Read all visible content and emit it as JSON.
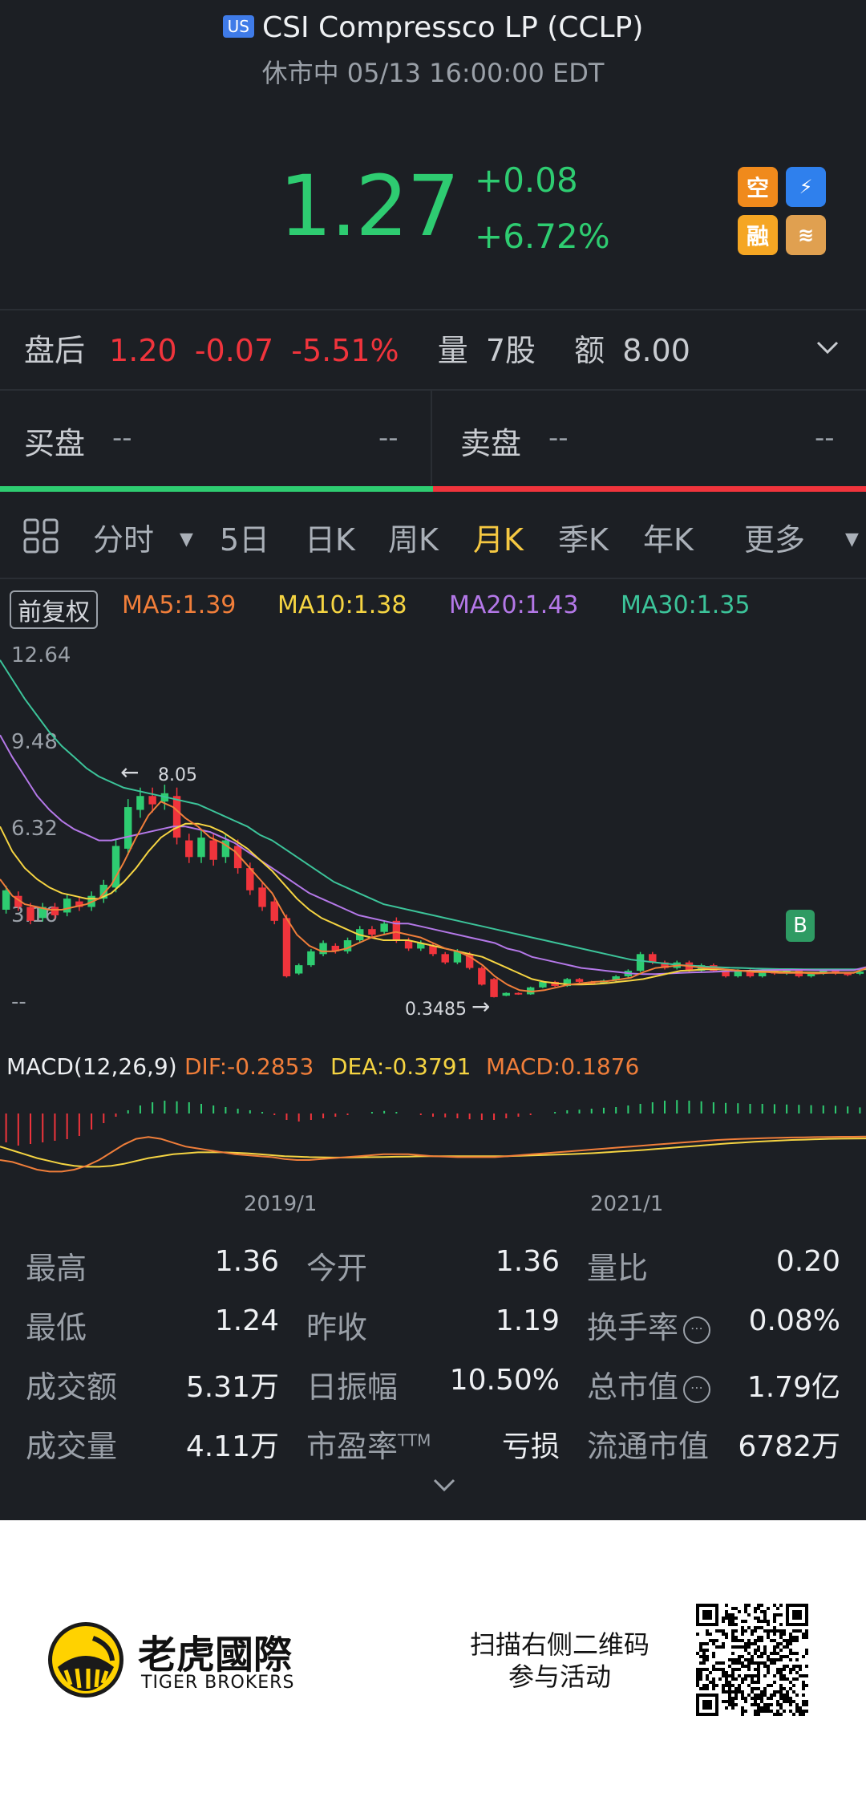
{
  "header": {
    "market_badge": "US",
    "title": "CSI Compressco LP (CCLP)",
    "status": "休市中 05/13 16:00:00 EDT",
    "price": "1.27",
    "change": "+0.08",
    "change_pct": "+6.72%",
    "icons": [
      {
        "name": "short-sell-icon",
        "text": "空",
        "color": "#f08a1c"
      },
      {
        "name": "level1-icon",
        "text": "⚡1",
        "color": "#2f80ed"
      },
      {
        "name": "margin-icon",
        "text": "融",
        "color": "#f5a623"
      },
      {
        "name": "options-icon",
        "text": "A",
        "color": "#e0a050"
      }
    ]
  },
  "after_hours": {
    "label": "盘后",
    "price": "1.20",
    "change": "-0.07",
    "change_pct": "-5.51%",
    "volume_label": "量",
    "volume": "7股",
    "amount_label": "额",
    "amount": "8.00"
  },
  "order_book": {
    "bid_label": "买盘",
    "bid_price": "--",
    "bid_size": "--",
    "ask_label": "卖盘",
    "ask_price": "--",
    "ask_size": "--"
  },
  "tabs": {
    "items": [
      "分时",
      "5日",
      "日K",
      "周K",
      "月K",
      "季K",
      "年K",
      "更多"
    ],
    "active": "月K"
  },
  "chart_legend": {
    "adjust": "前复权",
    "ma5": "MA5:1.39",
    "ma10": "MA10:1.38",
    "ma20": "MA20:1.43",
    "ma30": "MA30:1.35"
  },
  "colors": {
    "up": "#2ecc71",
    "down": "#f0343c",
    "ma5": "#f07e3a",
    "ma10": "#f5d442",
    "ma20": "#b478e8",
    "ma30": "#3cc49a",
    "accent": "#f5c842"
  },
  "chart_data": {
    "type": "candlestick",
    "y_ticks": [
      "12.64",
      "9.48",
      "6.32",
      "3.16",
      "--"
    ],
    "x_ticks": [
      "2019/1",
      "2021/1"
    ],
    "ylim": [
      0,
      12.64
    ],
    "annotations": {
      "high_label": "8.05",
      "low_label": "0.3485",
      "buy_marker": "B"
    },
    "candles": [
      {
        "o": 3.5,
        "c": 4.2
      },
      {
        "o": 4.0,
        "c": 3.6
      },
      {
        "o": 3.6,
        "c": 3.1
      },
      {
        "o": 3.2,
        "c": 3.6
      },
      {
        "o": 3.6,
        "c": 3.3
      },
      {
        "o": 3.4,
        "c": 3.9
      },
      {
        "o": 3.8,
        "c": 3.6
      },
      {
        "o": 3.6,
        "c": 4.0
      },
      {
        "o": 3.9,
        "c": 4.4
      },
      {
        "o": 4.3,
        "c": 5.8
      },
      {
        "o": 5.7,
        "c": 7.2
      },
      {
        "o": 7.1,
        "c": 7.6
      },
      {
        "o": 7.6,
        "c": 7.3
      },
      {
        "o": 7.4,
        "c": 7.7
      },
      {
        "o": 7.6,
        "c": 6.1
      },
      {
        "o": 6.0,
        "c": 5.4
      },
      {
        "o": 5.4,
        "c": 6.1
      },
      {
        "o": 6.0,
        "c": 5.3
      },
      {
        "o": 5.4,
        "c": 6.0
      },
      {
        "o": 5.8,
        "c": 5.0
      },
      {
        "o": 5.0,
        "c": 4.2
      },
      {
        "o": 4.3,
        "c": 3.6
      },
      {
        "o": 3.8,
        "c": 3.1
      },
      {
        "o": 3.2,
        "c": 1.1
      },
      {
        "o": 1.2,
        "c": 1.5
      },
      {
        "o": 1.5,
        "c": 2.0
      },
      {
        "o": 1.9,
        "c": 2.3
      },
      {
        "o": 2.2,
        "c": 2.0
      },
      {
        "o": 2.0,
        "c": 2.4
      },
      {
        "o": 2.4,
        "c": 2.8
      },
      {
        "o": 2.8,
        "c": 2.6
      },
      {
        "o": 2.7,
        "c": 3.0
      },
      {
        "o": 3.1,
        "c": 2.4
      },
      {
        "o": 2.4,
        "c": 2.1
      },
      {
        "o": 2.1,
        "c": 2.3
      },
      {
        "o": 2.2,
        "c": 1.9
      },
      {
        "o": 1.9,
        "c": 1.6
      },
      {
        "o": 1.6,
        "c": 2.0
      },
      {
        "o": 1.9,
        "c": 1.4
      },
      {
        "o": 1.4,
        "c": 0.8
      },
      {
        "o": 1.0,
        "c": 0.35
      },
      {
        "o": 0.4,
        "c": 0.5
      },
      {
        "o": 0.5,
        "c": 0.45
      },
      {
        "o": 0.45,
        "c": 0.7
      },
      {
        "o": 0.7,
        "c": 0.9
      },
      {
        "o": 0.9,
        "c": 0.75
      },
      {
        "o": 0.75,
        "c": 1.0
      },
      {
        "o": 1.0,
        "c": 0.9
      },
      {
        "o": 0.9,
        "c": 0.85
      },
      {
        "o": 0.85,
        "c": 0.95
      },
      {
        "o": 0.95,
        "c": 1.1
      },
      {
        "o": 1.1,
        "c": 1.3
      },
      {
        "o": 1.3,
        "c": 1.9
      },
      {
        "o": 1.9,
        "c": 1.6
      },
      {
        "o": 1.6,
        "c": 1.4
      },
      {
        "o": 1.4,
        "c": 1.6
      },
      {
        "o": 1.6,
        "c": 1.3
      },
      {
        "o": 1.3,
        "c": 1.5
      },
      {
        "o": 1.5,
        "c": 1.3
      },
      {
        "o": 1.3,
        "c": 1.1
      },
      {
        "o": 1.1,
        "c": 1.3
      },
      {
        "o": 1.3,
        "c": 1.1
      },
      {
        "o": 1.1,
        "c": 1.3
      },
      {
        "o": 1.3,
        "c": 1.2
      },
      {
        "o": 1.2,
        "c": 1.3
      },
      {
        "o": 1.3,
        "c": 1.1
      },
      {
        "o": 1.1,
        "c": 1.2
      },
      {
        "o": 1.2,
        "c": 1.3
      },
      {
        "o": 1.3,
        "c": 1.2
      },
      {
        "o": 1.2,
        "c": 1.15
      },
      {
        "o": 1.19,
        "c": 1.27
      }
    ],
    "ma5": [
      4.6,
      4.0,
      3.7,
      3.6,
      3.5,
      3.5,
      3.6,
      3.7,
      3.9,
      4.4,
      5.2,
      6.1,
      6.9,
      7.4,
      7.2,
      6.8,
      6.5,
      6.1,
      5.9,
      5.6,
      5.1,
      4.6,
      4.1,
      3.3,
      2.6,
      2.2,
      2.0,
      2.0,
      2.1,
      2.3,
      2.5,
      2.6,
      2.7,
      2.6,
      2.5,
      2.3,
      2.1,
      2.0,
      1.8,
      1.5,
      1.1,
      0.8,
      0.6,
      0.55,
      0.6,
      0.7,
      0.8,
      0.85,
      0.9,
      0.92,
      0.98,
      1.05,
      1.25,
      1.4,
      1.45,
      1.5,
      1.45,
      1.4,
      1.38,
      1.33,
      1.3,
      1.25,
      1.25,
      1.22,
      1.22,
      1.22,
      1.2,
      1.22,
      1.22,
      1.22,
      1.39
    ],
    "ma10": [
      6.5,
      5.6,
      5.0,
      4.6,
      4.3,
      4.1,
      4.0,
      3.9,
      3.9,
      4.1,
      4.5,
      5.0,
      5.6,
      6.1,
      6.4,
      6.6,
      6.6,
      6.5,
      6.3,
      6.0,
      5.7,
      5.3,
      4.9,
      4.4,
      3.9,
      3.5,
      3.2,
      3.0,
      2.8,
      2.6,
      2.5,
      2.4,
      2.4,
      2.4,
      2.3,
      2.2,
      2.1,
      2.0,
      1.9,
      1.8,
      1.6,
      1.4,
      1.2,
      1.0,
      0.9,
      0.85,
      0.8,
      0.8,
      0.82,
      0.85,
      0.9,
      0.95,
      1.0,
      1.1,
      1.2,
      1.3,
      1.32,
      1.35,
      1.35,
      1.33,
      1.3,
      1.28,
      1.27,
      1.26,
      1.25,
      1.24,
      1.23,
      1.23,
      1.23,
      1.23,
      1.38
    ],
    "ma20": [
      9.8,
      9.0,
      8.3,
      7.6,
      7.1,
      6.7,
      6.4,
      6.2,
      6.0,
      6.0,
      6.1,
      6.2,
      6.3,
      6.4,
      6.5,
      6.5,
      6.4,
      6.3,
      6.1,
      5.9,
      5.6,
      5.3,
      5.0,
      4.7,
      4.4,
      4.1,
      3.9,
      3.7,
      3.5,
      3.3,
      3.2,
      3.1,
      3.0,
      3.0,
      2.9,
      2.8,
      2.7,
      2.6,
      2.5,
      2.4,
      2.3,
      2.1,
      2.0,
      1.8,
      1.7,
      1.6,
      1.5,
      1.4,
      1.35,
      1.3,
      1.25,
      1.2,
      1.18,
      1.18,
      1.2,
      1.22,
      1.24,
      1.25,
      1.27,
      1.29,
      1.3,
      1.31,
      1.32,
      1.33,
      1.33,
      1.33,
      1.32,
      1.32,
      1.32,
      1.32,
      1.43
    ],
    "ma30": [
      12.5,
      11.8,
      11.1,
      10.5,
      9.9,
      9.4,
      9.0,
      8.6,
      8.3,
      8.1,
      7.9,
      7.8,
      7.7,
      7.6,
      7.5,
      7.4,
      7.3,
      7.1,
      6.9,
      6.7,
      6.5,
      6.2,
      6.0,
      5.7,
      5.4,
      5.1,
      4.8,
      4.5,
      4.3,
      4.1,
      3.9,
      3.7,
      3.6,
      3.5,
      3.4,
      3.3,
      3.2,
      3.1,
      3.0,
      2.9,
      2.8,
      2.7,
      2.6,
      2.5,
      2.4,
      2.3,
      2.2,
      2.1,
      2.0,
      1.9,
      1.8,
      1.7,
      1.65,
      1.6,
      1.55,
      1.5,
      1.48,
      1.45,
      1.43,
      1.41,
      1.4,
      1.38,
      1.37,
      1.36,
      1.36,
      1.35,
      1.35,
      1.35,
      1.35,
      1.35,
      1.35
    ],
    "macd": {
      "label": "MACD(12,26,9)",
      "dif_label": "DIF:-0.2853",
      "dea_label": "DEA:-0.3791",
      "macd_label": "MACD:0.1876",
      "hist": [
        -0.9,
        -1.0,
        -0.95,
        -0.9,
        -0.85,
        -0.8,
        -0.7,
        -0.5,
        -0.3,
        -0.1,
        0.1,
        0.25,
        0.35,
        0.4,
        0.38,
        0.35,
        0.3,
        0.25,
        0.2,
        0.15,
        0.1,
        0.05,
        -0.05,
        -0.2,
        -0.25,
        -0.2,
        -0.15,
        -0.1,
        -0.05,
        0.0,
        0.05,
        0.08,
        0.05,
        0.0,
        -0.05,
        -0.1,
        -0.12,
        -0.15,
        -0.18,
        -0.2,
        -0.2,
        -0.15,
        -0.1,
        -0.05,
        0.0,
        0.05,
        0.1,
        0.12,
        0.15,
        0.18,
        0.2,
        0.25,
        0.3,
        0.35,
        0.4,
        0.42,
        0.4,
        0.38,
        0.35,
        0.33,
        0.32,
        0.3,
        0.3,
        0.29,
        0.28,
        0.27,
        0.26,
        0.25,
        0.24,
        0.22,
        0.19
      ],
      "dif": [
        -1.5,
        -1.6,
        -1.8,
        -2.0,
        -2.1,
        -2.1,
        -2.0,
        -1.8,
        -1.5,
        -1.1,
        -0.7,
        -0.4,
        -0.3,
        -0.4,
        -0.6,
        -0.8,
        -0.9,
        -1.0,
        -1.1,
        -1.2,
        -1.25,
        -1.3,
        -1.35,
        -1.45,
        -1.5,
        -1.5,
        -1.45,
        -1.4,
        -1.35,
        -1.3,
        -1.25,
        -1.2,
        -1.2,
        -1.2,
        -1.25,
        -1.3,
        -1.32,
        -1.35,
        -1.35,
        -1.35,
        -1.35,
        -1.3,
        -1.25,
        -1.2,
        -1.15,
        -1.1,
        -1.05,
        -1.0,
        -0.95,
        -0.9,
        -0.85,
        -0.8,
        -0.75,
        -0.7,
        -0.65,
        -0.6,
        -0.55,
        -0.5,
        -0.46,
        -0.43,
        -0.4,
        -0.38,
        -0.36,
        -0.34,
        -0.33,
        -0.32,
        -0.31,
        -0.3,
        -0.29,
        -0.29,
        -0.285
      ],
      "dea": [
        -0.8,
        -1.0,
        -1.2,
        -1.4,
        -1.55,
        -1.7,
        -1.8,
        -1.85,
        -1.85,
        -1.8,
        -1.7,
        -1.55,
        -1.4,
        -1.3,
        -1.2,
        -1.15,
        -1.1,
        -1.1,
        -1.1,
        -1.12,
        -1.15,
        -1.2,
        -1.25,
        -1.3,
        -1.32,
        -1.35,
        -1.36,
        -1.37,
        -1.37,
        -1.36,
        -1.35,
        -1.34,
        -1.33,
        -1.32,
        -1.31,
        -1.3,
        -1.3,
        -1.3,
        -1.3,
        -1.3,
        -1.3,
        -1.3,
        -1.28,
        -1.26,
        -1.24,
        -1.22,
        -1.2,
        -1.17,
        -1.14,
        -1.1,
        -1.06,
        -1.02,
        -0.98,
        -0.93,
        -0.88,
        -0.83,
        -0.78,
        -0.73,
        -0.68,
        -0.63,
        -0.59,
        -0.55,
        -0.52,
        -0.49,
        -0.46,
        -0.44,
        -0.42,
        -0.4,
        -0.39,
        -0.385,
        -0.379
      ]
    }
  },
  "stats": [
    {
      "label": "最高",
      "value": "1.36"
    },
    {
      "label": "今开",
      "value": "1.36"
    },
    {
      "label": "量比",
      "value": "0.20"
    },
    {
      "label": "最低",
      "value": "1.24"
    },
    {
      "label": "昨收",
      "value": "1.19"
    },
    {
      "label": "换手率",
      "value": "0.08%"
    },
    {
      "label": "成交额",
      "value": "5.31万"
    },
    {
      "label": "日振幅",
      "value": "10.50%"
    },
    {
      "label": "总市值",
      "value": "1.79亿"
    },
    {
      "label": "成交量",
      "value": "4.11万"
    },
    {
      "label": "市盈率",
      "value": "亏损"
    },
    {
      "label": "流通市值",
      "value": "6782万"
    }
  ],
  "stats_extra": {
    "pe_suffix": "TTM",
    "info_icon": "⋯"
  },
  "footer": {
    "brand_cn": "老虎國際",
    "brand_en": "TIGER BROKERS",
    "promo_line1": "扫描右侧二维码",
    "promo_line2": "参与活动"
  }
}
